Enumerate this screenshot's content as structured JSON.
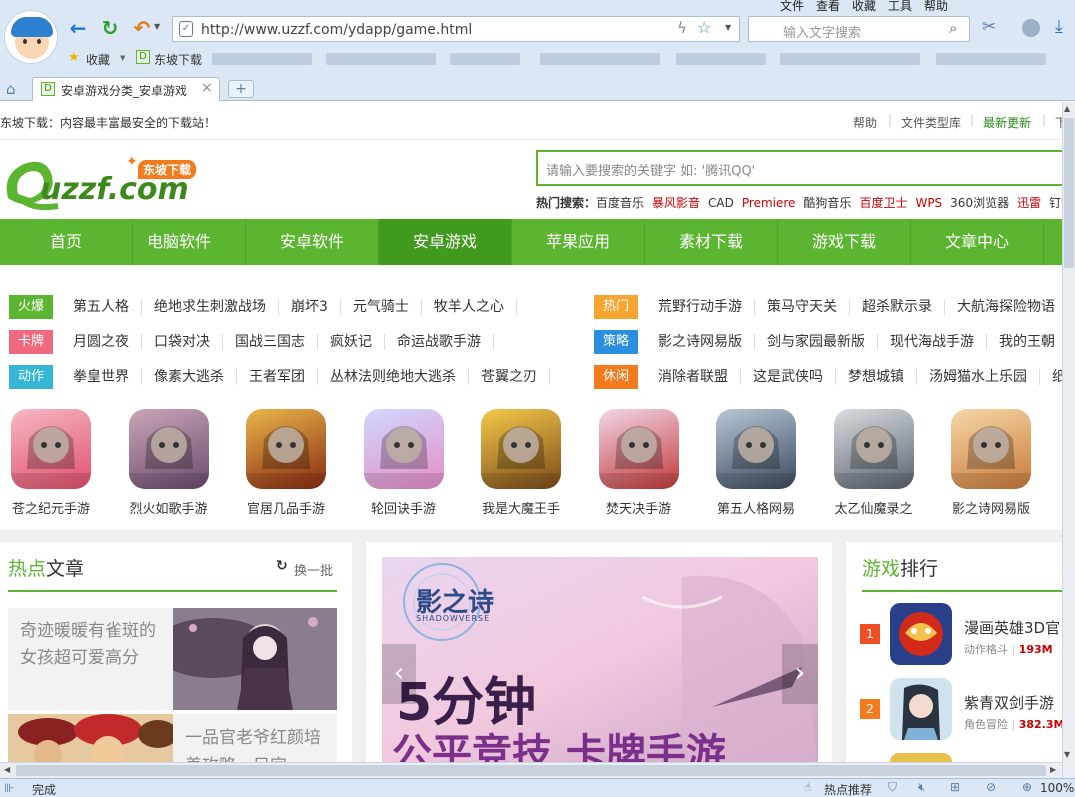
{
  "browser": {
    "menus": [
      "文件",
      "查看",
      "收藏",
      "工具",
      "帮助"
    ],
    "url": "http://www.uzzf.com/ydapp/game.html",
    "search_placeholder": "输入文字搜索",
    "bookmarks": [
      "收藏",
      "东坡下载"
    ],
    "tab_title": "安卓游戏分类_安卓游戏",
    "new_tab_label": "+",
    "status_text": "完成",
    "status_hot": "热点推荐",
    "zoom": "100%"
  },
  "site": {
    "slogan": "东坡下载：内容最丰富最安全的下载站！",
    "top_links": [
      "帮助",
      "文件类型库",
      "最新更新",
      "下"
    ],
    "logo_text": "uzzf.com",
    "logo_badge": "东坡下载",
    "search_placeholder": "请输入要搜索的关键字 如: '腾讯QQ'",
    "hot_label": "热门搜索：",
    "hot_links": [
      "百度音乐",
      "暴风影音",
      "CAD",
      "Premiere",
      "酷狗音乐",
      "百度卫士",
      "WPS",
      "360浏览器",
      "迅雷",
      "钉钉"
    ],
    "nav": [
      "首页",
      "电脑软件",
      "安卓软件",
      "安卓游戏",
      "苹果应用",
      "素材下载",
      "游戏下载",
      "文章中心"
    ],
    "nav_active": 3
  },
  "tags": {
    "left": [
      {
        "label": "火爆",
        "color": "#5cb531",
        "items": [
          "第五人格",
          "绝地求生刺激战场",
          "崩坏3",
          "元气骑士",
          "牧羊人之心"
        ]
      },
      {
        "label": "卡牌",
        "color": "#f06a7f",
        "items": [
          "月圆之夜",
          "口袋对决",
          "国战三国志",
          "疯妖记",
          "命运战歌手游"
        ]
      },
      {
        "label": "动作",
        "color": "#35b6d6",
        "items": [
          "拳皇世界",
          "像素大逃杀",
          "王者军团",
          "丛林法则绝地大逃杀",
          "苍翼之刃"
        ]
      }
    ],
    "right": [
      {
        "label": "热门",
        "color": "#f8a431",
        "items": [
          "荒野行动手游",
          "策马守天关",
          "超杀默示录",
          "大航海探险物语"
        ]
      },
      {
        "label": "策略",
        "color": "#2b8fe0",
        "items": [
          "影之诗网易版",
          "剑与家园最新版",
          "现代海战手游",
          "我的王朝"
        ]
      },
      {
        "label": "休闲",
        "color": "#f37b1d",
        "items": [
          "消除者联盟",
          "这是武侠吗",
          "梦想城镇",
          "汤姆猫水上乐园",
          "纸"
        ]
      }
    ]
  },
  "games": [
    {
      "name": "苍之纪元手游",
      "colors": [
        "#f7b7c4",
        "#e0506b"
      ]
    },
    {
      "name": "烈火如歌手游",
      "colors": [
        "#c9a6b8",
        "#6b4a6e"
      ]
    },
    {
      "name": "官居几品手游",
      "colors": [
        "#e8b64a",
        "#8a2a12"
      ]
    },
    {
      "name": "轮回诀手游",
      "colors": [
        "#cfd9ff",
        "#e68cc8"
      ]
    },
    {
      "name": "我是大魔王手",
      "colors": [
        "#f5c94a",
        "#7a4a1a"
      ]
    },
    {
      "name": "焚天决手游",
      "colors": [
        "#f2d5e6",
        "#c23b3b"
      ]
    },
    {
      "name": "第五人格网易",
      "colors": [
        "#b8c7d6",
        "#3a4a5c"
      ]
    },
    {
      "name": "太乙仙魔录之",
      "colors": [
        "#d9dde0",
        "#5a6270"
      ]
    },
    {
      "name": "影之诗网易版",
      "colors": [
        "#f6d7a8",
        "#c97a3a"
      ]
    }
  ],
  "articles": {
    "title_hl": "热点",
    "title_rest": "文章",
    "refresh": "换一批",
    "items": [
      {
        "text": "奇迹暖暖有雀斑的女孩超可爱高分"
      },
      {
        "text": "一品官老爷红颜培养攻略，只宜"
      }
    ]
  },
  "banner": {
    "logo": "影之诗",
    "sub": "SHADOWVERSE",
    "headline": "5分钟",
    "line2": "公平竞技 卡牌手游"
  },
  "ranking": {
    "title_hl": "游戏",
    "title_rest": "排行",
    "items": [
      {
        "rank": "1",
        "name": "漫画英雄3D官",
        "cat": "动作格斗",
        "size": "193M",
        "rank_color": "#f04e23"
      },
      {
        "rank": "2",
        "name": "紫青双剑手游",
        "cat": "角色冒险",
        "size": "382.3M",
        "rank_color": "#f37b1d"
      }
    ]
  }
}
